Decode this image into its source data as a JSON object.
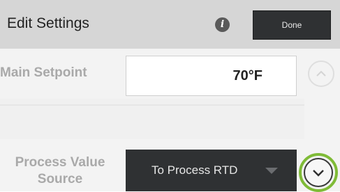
{
  "header": {
    "title": "Edit Settings",
    "info_icon": "info-icon",
    "done_label": "Done"
  },
  "main_setpoint": {
    "label": "Main Setpoint",
    "value": "70°F"
  },
  "process_value_source": {
    "label_line1": "Process Value",
    "label_line2": "Source",
    "selected": "To Process RTD",
    "icon": "chevron-down-icon"
  },
  "scroll": {
    "up_icon": "chevron-up-icon",
    "down_icon": "chevron-down-icon",
    "highlight_color": "#7fbb37"
  },
  "colors": {
    "header_bg": "#d6d6d6",
    "button_bg": "#2f3133",
    "content_bg": "#f3f3f3"
  }
}
